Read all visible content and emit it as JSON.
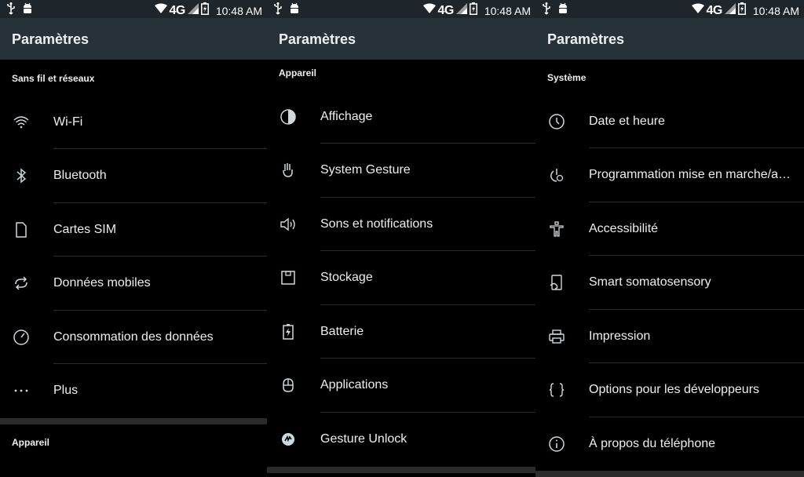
{
  "status": {
    "network": "4G",
    "time": "10:48 AM"
  },
  "panels": [
    {
      "title": "Paramètres",
      "section": "Sans fil et réseaux",
      "items": [
        {
          "label": "Wi-Fi",
          "icon": "wifi-icon"
        },
        {
          "label": "Bluetooth",
          "icon": "bluetooth-icon"
        },
        {
          "label": "Cartes SIM",
          "icon": "sim-card-icon"
        },
        {
          "label": "Données mobiles",
          "icon": "mobile-data-icon"
        },
        {
          "label": "Consommation des données",
          "icon": "data-usage-icon"
        },
        {
          "label": "Plus",
          "icon": "more-icon"
        }
      ],
      "next_section": "Appareil"
    },
    {
      "title": "Paramètres",
      "section": "Appareil",
      "items": [
        {
          "label": "Affichage",
          "icon": "display-icon"
        },
        {
          "label": "System Gesture",
          "icon": "gesture-icon"
        },
        {
          "label": "Sons et notifications",
          "icon": "volume-icon"
        },
        {
          "label": "Stockage",
          "icon": "storage-icon"
        },
        {
          "label": "Batterie",
          "icon": "battery-icon"
        },
        {
          "label": "Applications",
          "icon": "apps-icon"
        },
        {
          "label": "Gesture Unlock",
          "icon": "gesture-unlock-icon"
        }
      ]
    },
    {
      "title": "Paramètres",
      "section": "Système",
      "items": [
        {
          "label": "Date et heure",
          "icon": "clock-icon"
        },
        {
          "label": "Programmation mise en marche/a…",
          "icon": "power-schedule-icon"
        },
        {
          "label": "Accessibilité",
          "icon": "accessibility-icon"
        },
        {
          "label": "Smart somatosensory",
          "icon": "somatosensory-icon"
        },
        {
          "label": "Impression",
          "icon": "print-icon"
        },
        {
          "label": "Options pour les développeurs",
          "icon": "developer-options-icon"
        },
        {
          "label": "À propos du téléphone",
          "icon": "info-icon"
        }
      ]
    }
  ]
}
